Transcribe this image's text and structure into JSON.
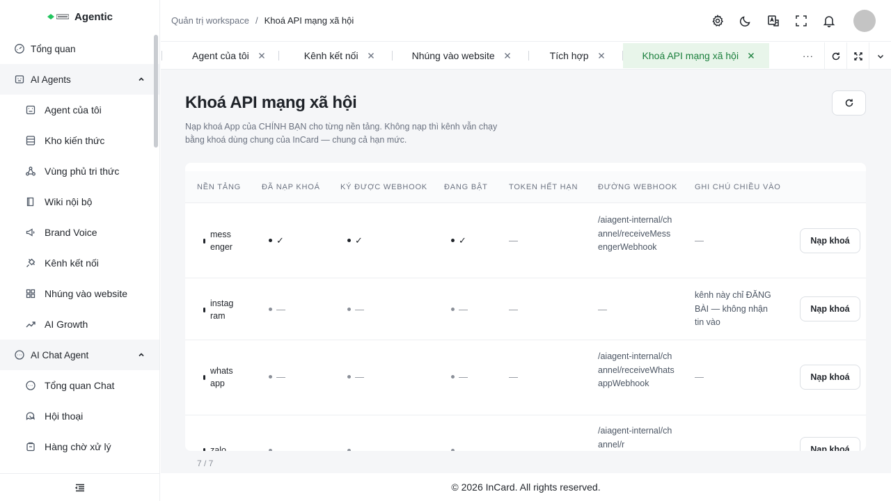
{
  "brand": {
    "name": "Agentic",
    "logo_text": "incard",
    "accent": "#22c55e"
  },
  "sidebar": {
    "overview": "Tổng quan",
    "groups": [
      {
        "label": "AI Agents",
        "icon": "robot-icon",
        "items": [
          {
            "label": "Agent của tôi",
            "icon": "agent-icon"
          },
          {
            "label": "Kho kiến thức",
            "icon": "database-icon"
          },
          {
            "label": "Vùng phủ tri thức",
            "icon": "network-icon"
          },
          {
            "label": "Wiki nội bộ",
            "icon": "book-icon"
          },
          {
            "label": "Brand Voice",
            "icon": "megaphone-icon"
          },
          {
            "label": "Kênh kết nối",
            "icon": "plug-icon"
          },
          {
            "label": "Nhúng vào website",
            "icon": "grid-icon"
          },
          {
            "label": "AI Growth",
            "icon": "trending-up-icon"
          }
        ]
      },
      {
        "label": "AI Chat Agent",
        "icon": "chat-icon",
        "items": [
          {
            "label": "Tổng quan Chat",
            "icon": "chat-bubble-icon"
          },
          {
            "label": "Hội thoại",
            "icon": "conversation-icon"
          },
          {
            "label": "Hàng chờ xử lý",
            "icon": "inbox-icon"
          }
        ]
      }
    ]
  },
  "header": {
    "breadcrumb_parent": "Quản trị workspace",
    "breadcrumb_sep": "/",
    "breadcrumb_current": "Khoá API mạng xã hội"
  },
  "tabs": [
    {
      "label": "Agent của tôi"
    },
    {
      "label": "Kênh kết nối"
    },
    {
      "label": "Nhúng vào website"
    },
    {
      "label": "Tích hợp"
    },
    {
      "label": "Khoá API mạng xã hội",
      "active": true
    }
  ],
  "tabs_more": "···",
  "page": {
    "title": "Khoá API mạng xã hội",
    "description": "Nạp khoá App của CHÍNH BẠN cho từng nền tảng. Không nạp thì kênh vẫn chạy bằng khoá dùng chung của InCard — chung cả hạn mức."
  },
  "table": {
    "columns": [
      "Nền tảng",
      "Đã nạp khoá",
      "Ký được webhook",
      "Đang bật",
      "Token hết hạn",
      "Đường webhook",
      "Ghi chú chiều vào"
    ],
    "action_label": "Nạp khoá",
    "rows": [
      {
        "platform": "messenger",
        "has_key": "✓",
        "can_sign": "✓",
        "enabled": "✓",
        "token_expiry": "—",
        "webhook": "/aiagent-internal/channel/receiveMessengerWebhook",
        "note": "—",
        "active": true
      },
      {
        "platform": "instagram",
        "has_key": "—",
        "can_sign": "—",
        "enabled": "—",
        "token_expiry": "—",
        "webhook": "—",
        "note": "kênh này chỉ ĐĂNG BÀI — không nhận tin vào",
        "active": false
      },
      {
        "platform": "whatsapp",
        "has_key": "—",
        "can_sign": "—",
        "enabled": "—",
        "token_expiry": "—",
        "webhook": "/aiagent-internal/channel/receiveWhatsappWebhook",
        "note": "—",
        "active": false
      },
      {
        "platform": "zalo",
        "has_key": "—",
        "can_sign": "—",
        "enabled": "—",
        "token_expiry": "—",
        "webhook": "/aiagent-internal/channel/r",
        "note": "—",
        "active": false
      }
    ],
    "pager": "7 / 7"
  },
  "footer": "© 2026 InCard. All rights reserved."
}
